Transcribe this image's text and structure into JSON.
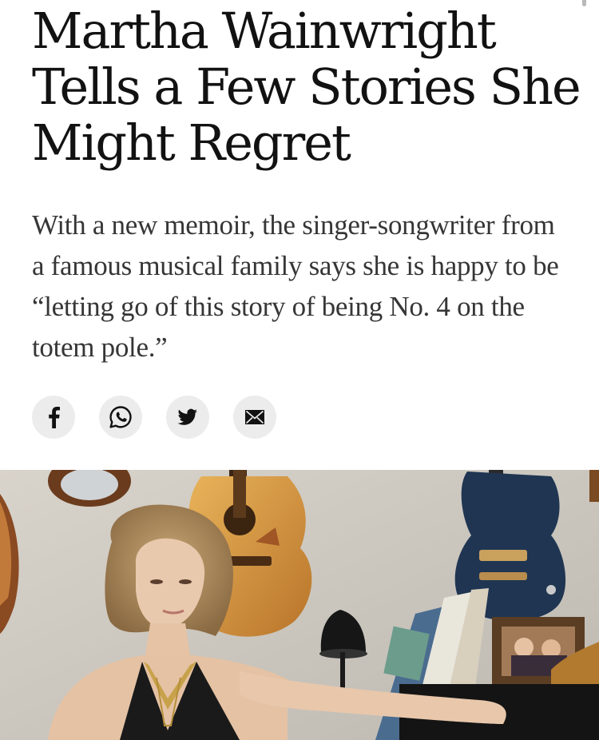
{
  "article": {
    "headline": "Martha Wainwright Tells a Few Stories She Might Regret",
    "summary": "With a new memoir, the singer-songwriter from a famous musical family says she is happy to be “letting go of this story of being No. 4 on the totem pole.”"
  },
  "share": {
    "buttons": [
      {
        "name": "facebook",
        "icon": "facebook-icon"
      },
      {
        "name": "whatsapp",
        "icon": "whatsapp-icon"
      },
      {
        "name": "twitter",
        "icon": "twitter-icon"
      },
      {
        "name": "email",
        "icon": "mail-icon"
      }
    ]
  },
  "hero_image": {
    "description_icon": "photo",
    "colors": {
      "wall": "#cfcac2",
      "guitar_natural": "#d79a3e",
      "guitar_blue": "#1f3552",
      "dress": "#1a1a1a"
    }
  }
}
